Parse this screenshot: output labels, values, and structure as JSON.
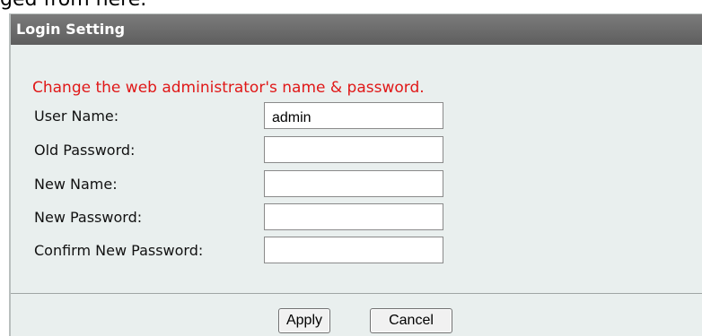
{
  "top_text": "ged from here.",
  "panel": {
    "title": "Login Setting",
    "intro": "Change the web administrator's name & password."
  },
  "fields": [
    {
      "label": "User Name:",
      "value": "admin"
    },
    {
      "label": "Old Password:",
      "value": ""
    },
    {
      "label": "New Name:",
      "value": ""
    },
    {
      "label": "New Password:",
      "value": ""
    },
    {
      "label": "Confirm New Password:",
      "value": ""
    }
  ],
  "buttons": {
    "apply_label": "Apply",
    "cancel_label": "Cancel"
  },
  "colors": {
    "header_bg": "#6b6b6b",
    "panel_bg": "#e9efee",
    "intro_text": "#e01818"
  }
}
